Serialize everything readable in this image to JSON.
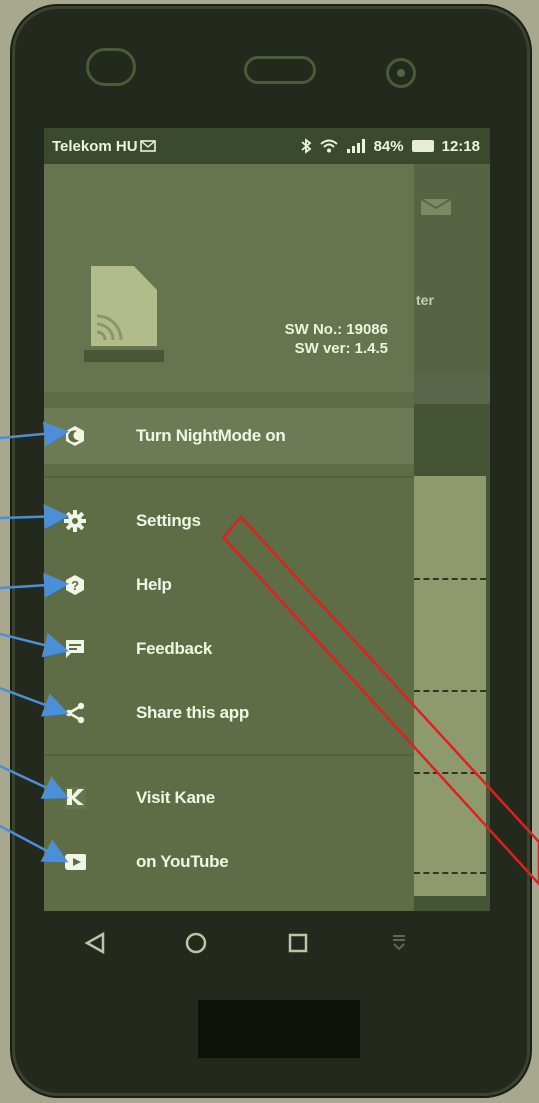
{
  "status_bar": {
    "carrier": "Telekom HU",
    "battery_percent": "84%",
    "time": "12:18"
  },
  "drawer": {
    "sw_number": "SW No.: 19086",
    "sw_version": "SW ver: 1.4.5",
    "items": [
      {
        "label": "Turn NightMode on",
        "icon": "night-mode-icon"
      },
      {
        "label": "Settings",
        "icon": "gear-icon"
      },
      {
        "label": "Help",
        "icon": "help-icon"
      },
      {
        "label": "Feedback",
        "icon": "feedback-icon"
      },
      {
        "label": "Share this app",
        "icon": "share-icon"
      },
      {
        "label": "Visit Kane",
        "icon": "kane-logo-icon"
      },
      {
        "label": "on YouTube",
        "icon": "youtube-icon"
      }
    ]
  },
  "background_app": {
    "partial_label": "ter"
  },
  "colors": {
    "arrow": "#4a8fd8",
    "highlight_box": "#e02020",
    "screen_tint": "#5f6d47"
  }
}
